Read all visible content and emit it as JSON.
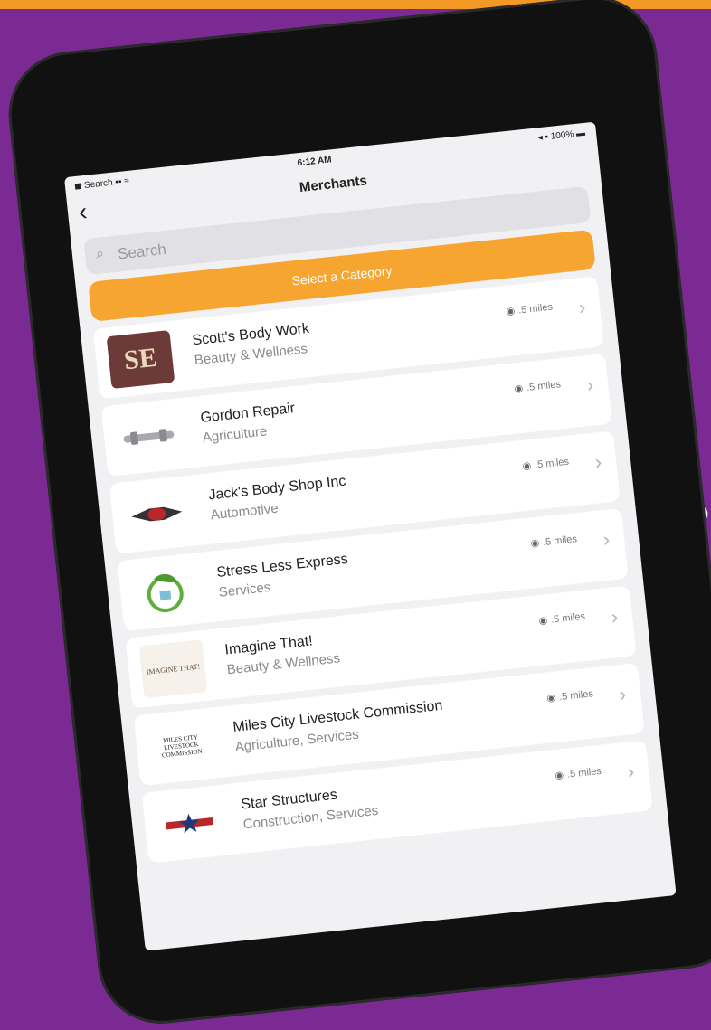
{
  "promo": {
    "letter": "P"
  },
  "status_bar": {
    "left": "◼ Search ▪▪ ≈",
    "time": "6:12 AM",
    "right": "◂ ▪ 100% ▬"
  },
  "nav": {
    "back_icon": "chevron-left",
    "title": "Merchants"
  },
  "search": {
    "placeholder": "Search"
  },
  "category_button": {
    "label": "Select a Category"
  },
  "merchants": [
    {
      "name": "Scott's Body Work",
      "category": "Beauty & Wellness",
      "distance": ".5 miles",
      "logo": "SE"
    },
    {
      "name": "Gordon Repair",
      "category": "Agriculture",
      "distance": ".5 miles",
      "logo": ""
    },
    {
      "name": "Jack's Body Shop Inc",
      "category": "Automotive",
      "distance": ".5 miles",
      "logo": ""
    },
    {
      "name": "Stress Less Express",
      "category": "Services",
      "distance": ".5 miles",
      "logo": ""
    },
    {
      "name": "Imagine That!",
      "category": "Beauty & Wellness",
      "distance": ".5 miles",
      "logo": "IMAGINE THAT!"
    },
    {
      "name": "Miles City Livestock Commission",
      "category": "Agriculture, Services",
      "distance": ".5 miles",
      "logo": "MILES CITY LIVESTOCK COMMISSION"
    },
    {
      "name": "Star Structures",
      "category": "Construction, Services",
      "distance": ".5 miles",
      "logo": ""
    }
  ],
  "colors": {
    "background": "#7b2a93",
    "accent": "#f7a531"
  }
}
